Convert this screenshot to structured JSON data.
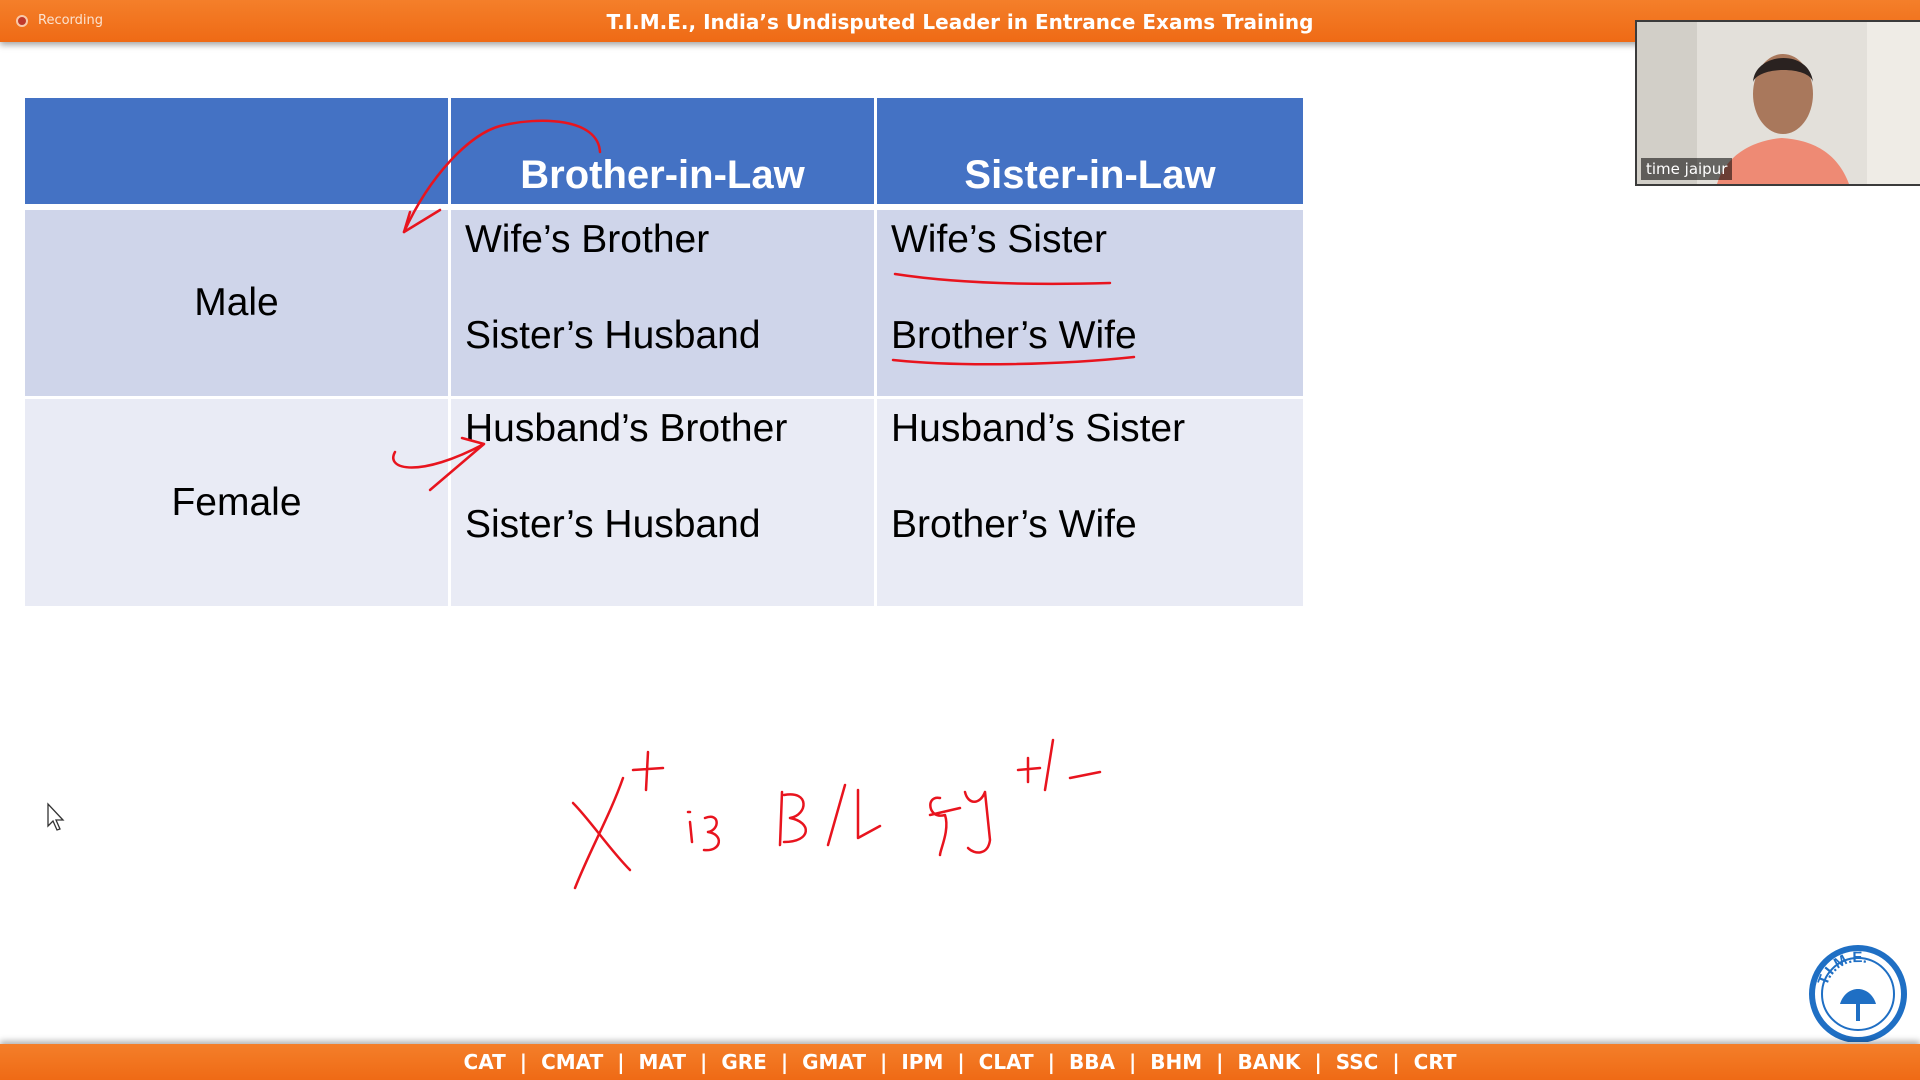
{
  "recording_label": "Recording",
  "banner_title": "T.I.M.E., India’s Undisputed Leader in Entrance Exams Training",
  "table": {
    "headers": [
      "",
      "Brother-in-Law",
      "Sister-in-Law"
    ],
    "rows": [
      {
        "label": "Male",
        "brother_in_law": [
          "Wife’s Brother",
          "Sister’s Husband"
        ],
        "sister_in_law": [
          "Wife’s Sister",
          "Brother’s Wife"
        ]
      },
      {
        "label": "Female",
        "brother_in_law": [
          "Husband’s Brother",
          "Sister’s Husband"
        ],
        "sister_in_law": [
          "Husband’s Sister",
          "Brother’s Wife"
        ]
      }
    ]
  },
  "webcam": {
    "name": "time jaipur"
  },
  "exams": [
    "CAT",
    "CMAT",
    "MAT",
    "GRE",
    "GMAT",
    "IPM",
    "CLAT",
    "BBA",
    "BHM",
    "BANK",
    "SSC",
    "CRT"
  ],
  "logo_text": "T.I.M.E.",
  "colors": {
    "banner": "#ef6a15",
    "table_header": "#4472c4",
    "row1": "#cfd5ea",
    "row2": "#e9ebf5",
    "ink": "#e8141e"
  },
  "icons": [
    "record-icon",
    "mouse-cursor-icon",
    "time-logo"
  ]
}
